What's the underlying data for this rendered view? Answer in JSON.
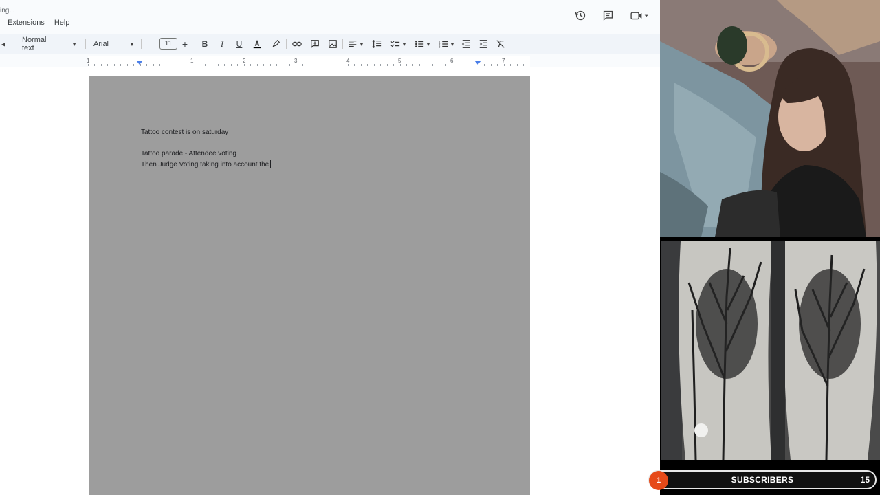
{
  "app": {
    "saving_status": "ing...",
    "menu": [
      "Extensions",
      "Help"
    ]
  },
  "topbar_icons": [
    "version-history-icon",
    "comments-icon",
    "meet-icon"
  ],
  "toolbar": {
    "style": "Normal text",
    "font": "Arial",
    "font_size": "11",
    "decrease_label": "–",
    "increase_label": "+"
  },
  "ruler": {
    "numbers": [
      "1",
      "1",
      "2",
      "3",
      "4",
      "5",
      "6",
      "7"
    ]
  },
  "document": {
    "lines": [
      "Tattoo contest is on saturday",
      "Tattoo parade - Attendee voting",
      "Then Judge Voting taking into account the"
    ]
  },
  "subscribers": {
    "badge": "1",
    "label": "SUBSCRIBERS",
    "count": "15"
  },
  "colors": {
    "page_gray": "#9d9d9d",
    "toolbar_bg": "#f0f4f9",
    "sub_badge": "#e64a19",
    "ruler_marker": "#4a7ee8"
  }
}
